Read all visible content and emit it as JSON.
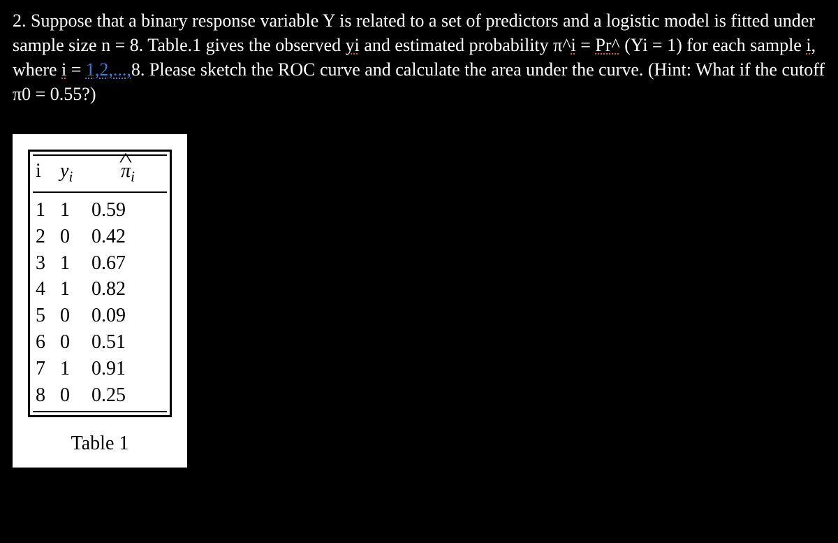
{
  "question": {
    "num": "2.",
    "part1": "Suppose that a binary response variable Y is related to a set of predictors and a logistic model is fitted under sample size n = 8. Table.1 gives the observed ",
    "yi": "yi",
    "part2": " and estimated probability π^",
    "ihat": "i",
    "part3": " = ",
    "pr": "Pr^",
    "part4": " (Yi = 1) for each sample ",
    "i1": "i",
    "part5": ", where ",
    "i2": "i",
    "part6": " = ",
    "range": "1,2,...,",
    "part7": "8. Please sketch the ROC curve and calculate the area under the curve. (Hint: What if the cutoff π0 = 0.55?)"
  },
  "table": {
    "headers": {
      "i": "i",
      "y": "y",
      "ysub": "i",
      "pi": "π̂",
      "pisub": "i"
    },
    "rows": [
      {
        "i": "1",
        "y": "1",
        "pi": "0.59"
      },
      {
        "i": "2",
        "y": "0",
        "pi": "0.42"
      },
      {
        "i": "3",
        "y": "1",
        "pi": "0.67"
      },
      {
        "i": "4",
        "y": "1",
        "pi": "0.82"
      },
      {
        "i": "5",
        "y": "0",
        "pi": "0.09"
      },
      {
        "i": "6",
        "y": "0",
        "pi": "0.51"
      },
      {
        "i": "7",
        "y": "1",
        "pi": "0.91"
      },
      {
        "i": "8",
        "y": "0",
        "pi": "0.25"
      }
    ],
    "caption": "Table 1"
  },
  "chart_data": {
    "type": "table",
    "title": "Table 1",
    "columns": [
      "i",
      "y_i",
      "pi_hat_i"
    ],
    "rows": [
      [
        1,
        1,
        0.59
      ],
      [
        2,
        0,
        0.42
      ],
      [
        3,
        1,
        0.67
      ],
      [
        4,
        1,
        0.82
      ],
      [
        5,
        0,
        0.09
      ],
      [
        6,
        0,
        0.51
      ],
      [
        7,
        1,
        0.91
      ],
      [
        8,
        0,
        0.25
      ]
    ]
  }
}
